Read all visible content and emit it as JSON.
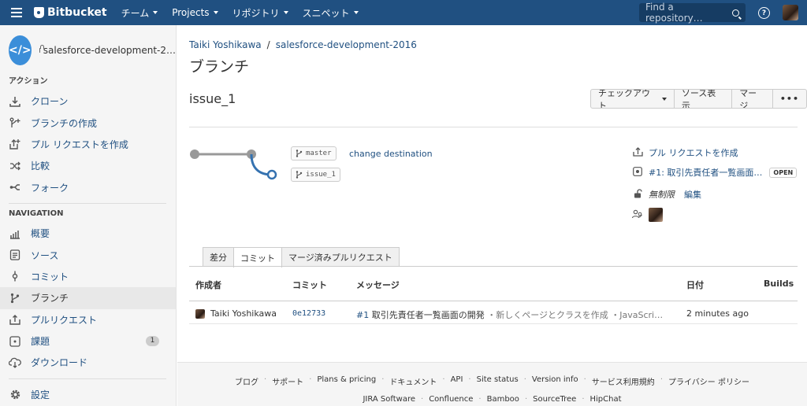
{
  "topbar": {
    "brand": "Bitbucket",
    "nav": [
      "チーム",
      "Projects",
      "リポジトリ",
      "スニペット"
    ],
    "search_placeholder": "Find a repository…",
    "help": "?"
  },
  "sidebar": {
    "repo_icon": "</>",
    "repo_name": "salesforce-development-2…",
    "section_actions": "アクション",
    "actions": [
      {
        "label": "クローン",
        "icon": "clone-icon"
      },
      {
        "label": "ブランチの作成",
        "icon": "create-branch-icon"
      },
      {
        "label": "プル リクエストを作成",
        "icon": "create-pull-request-icon"
      },
      {
        "label": "比較",
        "icon": "compare-icon"
      },
      {
        "label": "フォーク",
        "icon": "fork-icon"
      }
    ],
    "section_navigation": "NAVIGATION",
    "navigation": [
      {
        "label": "概要",
        "icon": "overview-icon"
      },
      {
        "label": "ソース",
        "icon": "source-icon"
      },
      {
        "label": "コミット",
        "icon": "commits-icon"
      },
      {
        "label": "ブランチ",
        "icon": "branches-icon",
        "active": true
      },
      {
        "label": "プルリクエスト",
        "icon": "pull-requests-icon"
      },
      {
        "label": "課題",
        "icon": "issues-icon",
        "badge": "1"
      },
      {
        "label": "ダウンロード",
        "icon": "downloads-icon"
      }
    ],
    "settings": "設定"
  },
  "main": {
    "breadcrumb": [
      "Taiki Yoshikawa",
      "salesforce-development-2016"
    ],
    "breadcrumb_sep": "/",
    "title": "ブランチ",
    "branch_name": "issue_1",
    "buttons": {
      "checkout": "チェックアウト",
      "view_source": "ソース表示",
      "merge": "マージ",
      "more": "•••"
    },
    "branch_tags": {
      "base": "master",
      "head": "issue_1"
    },
    "change_destination": "change destination",
    "meta": {
      "create_pr": "プル リクエストを作成",
      "pr_link": "#1: 取引先責任者一覧画面…",
      "pr_status": "OPEN",
      "permission": "無制限",
      "edit": "編集"
    },
    "tabs": [
      "差分",
      "コミット",
      "マージ済みプルリクエスト"
    ],
    "active_tab": 1,
    "table": {
      "headers": {
        "author": "作成者",
        "commit": "コミット",
        "message": "メッセージ",
        "date": "日付",
        "builds": "Builds"
      },
      "rows": [
        {
          "author": "Taiki Yoshikawa",
          "commit": "0e12733",
          "issue_ref": "#1",
          "message": "取引先責任者一覧画面の開発",
          "detail": "・新しくページとクラスを作成 ・JavaScri…",
          "date": "2 minutes ago"
        }
      ]
    }
  },
  "footer": {
    "row1": [
      "ブログ",
      "サポート",
      "Plans & pricing",
      "ドキュメント",
      "API",
      "Site status",
      "Version info",
      "サービス利用規約",
      "プライバシー ポリシー"
    ],
    "row2": [
      "JIRA Software",
      "Confluence",
      "Bamboo",
      "SourceTree",
      "HipChat"
    ]
  }
}
